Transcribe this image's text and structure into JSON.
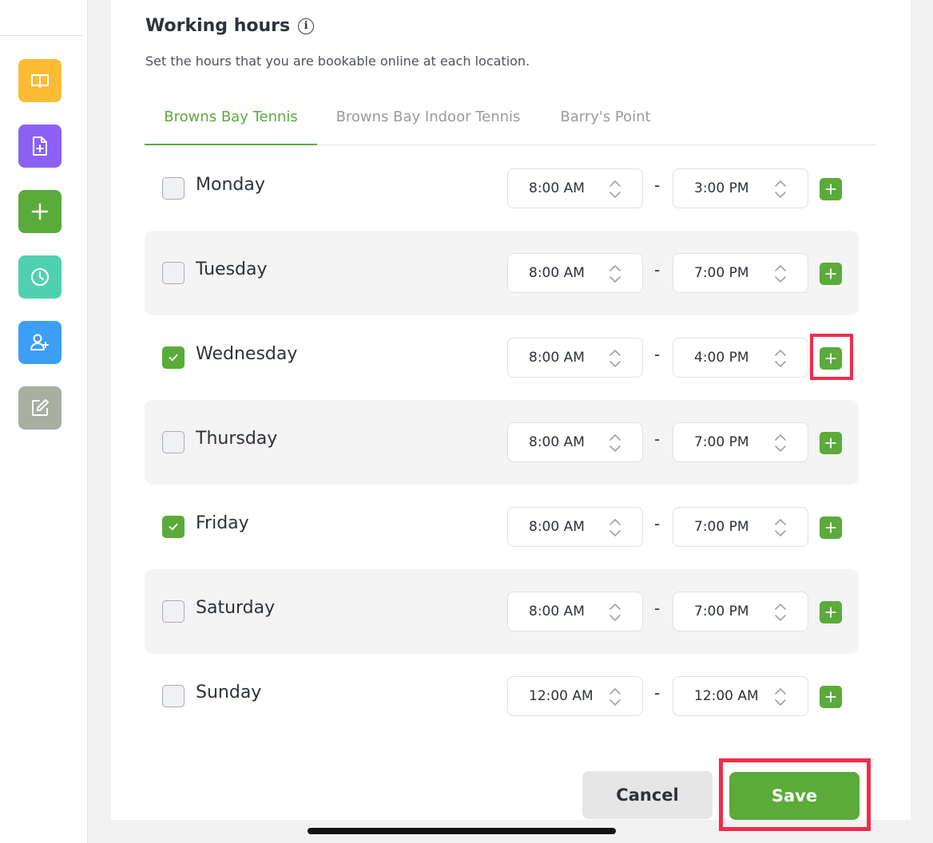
{
  "colors": {
    "accent": "#5aab3a",
    "highlight": "#ef2d4a",
    "sidebar_book": "#fbbb35",
    "sidebar_doc": "#8b61f3",
    "sidebar_add": "#5aab3a",
    "sidebar_clock": "#4fd1b1",
    "sidebar_user": "#3d9ef5",
    "sidebar_edit": "#a8aea0"
  },
  "sidebar": {
    "items": [
      {
        "icon": "book-icon"
      },
      {
        "icon": "file-add-icon"
      },
      {
        "icon": "plus-icon"
      },
      {
        "icon": "clock-icon"
      },
      {
        "icon": "user-add-icon"
      },
      {
        "icon": "edit-icon"
      }
    ]
  },
  "header": {
    "title": "Working hours",
    "info_icon": "i",
    "subtitle": "Set the hours that you are bookable online at each location."
  },
  "tabs": [
    {
      "label": "Browns Bay Tennis",
      "active": true
    },
    {
      "label": "Browns Bay Indoor Tennis",
      "active": false
    },
    {
      "label": "Barry's Point",
      "active": false
    }
  ],
  "separator": "-",
  "days": [
    {
      "name": "Monday",
      "checked": false,
      "start": "8:00 AM",
      "end": "3:00 PM"
    },
    {
      "name": "Tuesday",
      "checked": false,
      "start": "8:00 AM",
      "end": "7:00 PM"
    },
    {
      "name": "Wednesday",
      "checked": true,
      "start": "8:00 AM",
      "end": "4:00 PM"
    },
    {
      "name": "Thursday",
      "checked": false,
      "start": "8:00 AM",
      "end": "7:00 PM"
    },
    {
      "name": "Friday",
      "checked": true,
      "start": "8:00 AM",
      "end": "7:00 PM"
    },
    {
      "name": "Saturday",
      "checked": false,
      "start": "8:00 AM",
      "end": "7:00 PM"
    },
    {
      "name": "Sunday",
      "checked": false,
      "start": "12:00 AM",
      "end": "12:00 AM"
    }
  ],
  "footer": {
    "cancel_label": "Cancel",
    "save_label": "Save"
  }
}
